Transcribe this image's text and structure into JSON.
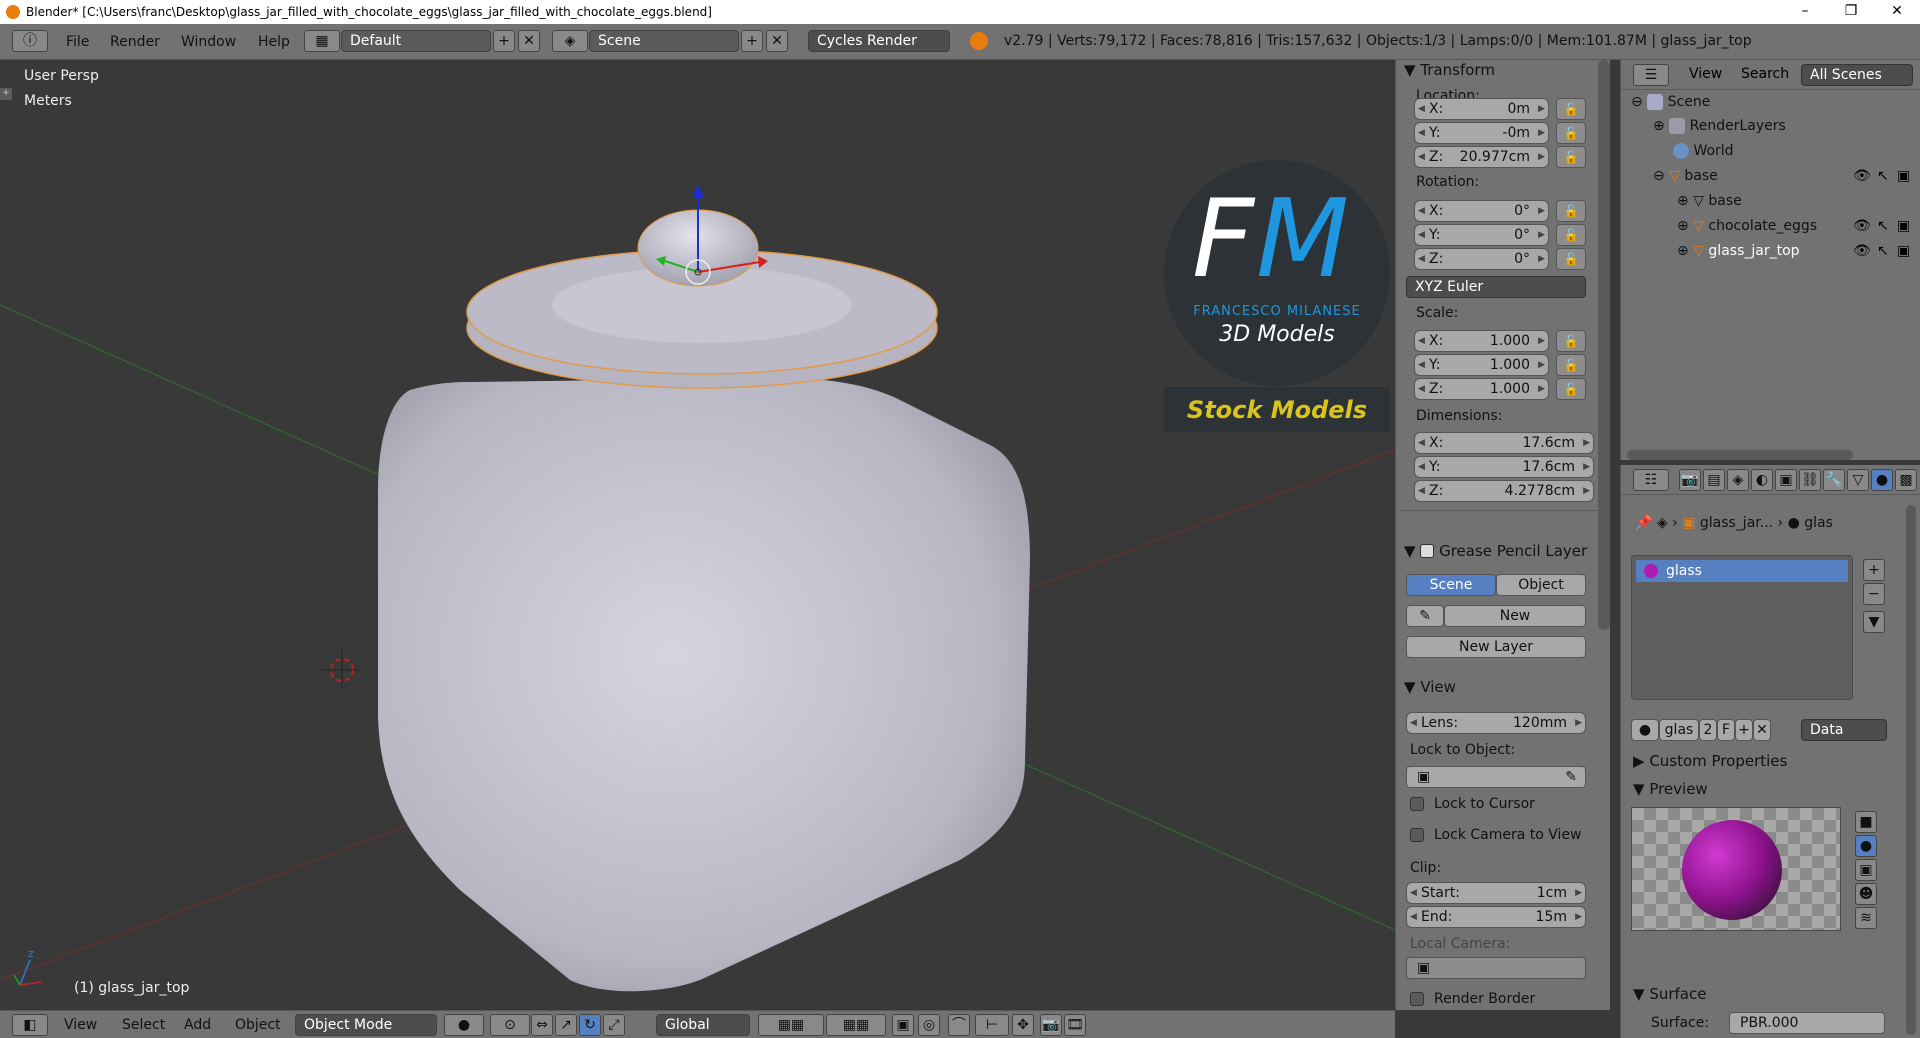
{
  "window": {
    "title": "Blender* [C:\\Users\\franc\\Desktop\\glass_jar_filled_with_chocolate_eggs\\glass_jar_filled_with_chocolate_eggs.blend]",
    "minimize": "–",
    "maximize": "❐",
    "close": "✕"
  },
  "menubar": {
    "menus": [
      "File",
      "Render",
      "Window",
      "Help"
    ],
    "layout": "Default",
    "scene": "Scene",
    "engine": "Cycles Render",
    "stats": "v2.79 | Verts:79,172 | Faces:78,816 | Tris:157,632 | Objects:1/3 | Lamps:0/0 | Mem:101.87M | glass_jar_top"
  },
  "viewport": {
    "view_name": "User Persp",
    "units": "Meters",
    "active_object": "(1) glass_jar_top",
    "axis_z": "z",
    "watermark": {
      "initials_f": "F",
      "initials_m": "M",
      "author": "FRANCESCO MILANESE",
      "sub": "3D Models",
      "stock": "Stock Models"
    }
  },
  "footer": {
    "menus": [
      "View",
      "Select",
      "Add",
      "Object"
    ],
    "mode": "Object Mode",
    "orientation": "Global"
  },
  "npanel": {
    "transform_header": "Transform",
    "location_label": "Location:",
    "location": [
      {
        "k": "X:",
        "v": "0m"
      },
      {
        "k": "Y:",
        "v": "-0m"
      },
      {
        "k": "Z:",
        "v": "20.977cm"
      }
    ],
    "rotation_label": "Rotation:",
    "rotation": [
      {
        "k": "X:",
        "v": "0°"
      },
      {
        "k": "Y:",
        "v": "0°"
      },
      {
        "k": "Z:",
        "v": "0°"
      }
    ],
    "rotation_mode": "XYZ Euler",
    "scale_label": "Scale:",
    "scale": [
      {
        "k": "X:",
        "v": "1.000"
      },
      {
        "k": "Y:",
        "v": "1.000"
      },
      {
        "k": "Z:",
        "v": "1.000"
      }
    ],
    "dimensions_label": "Dimensions:",
    "dimensions": [
      {
        "k": "X:",
        "v": "17.6cm"
      },
      {
        "k": "Y:",
        "v": "17.6cm"
      },
      {
        "k": "Z:",
        "v": "4.2778cm"
      }
    ],
    "gp_header": "Grease Pencil Layer",
    "gp_scene": "Scene",
    "gp_object": "Object",
    "gp_new": "New",
    "gp_new_layer": "New Layer",
    "view_header": "View",
    "lens_k": "Lens:",
    "lens_v": "120mm",
    "lock_to_object": "Lock to Object:",
    "lock_to_cursor": "Lock to Cursor",
    "lock_camera": "Lock Camera to View",
    "clip_label": "Clip:",
    "clip_start_k": "Start:",
    "clip_start_v": "1cm",
    "clip_end_k": "End:",
    "clip_end_v": "15m",
    "local_camera": "Local Camera:",
    "render_border": "Render Border"
  },
  "outliner": {
    "tabs": [
      "View",
      "Search",
      "All Scenes"
    ],
    "items": [
      {
        "label": "Scene"
      },
      {
        "label": "RenderLayers"
      },
      {
        "label": "World"
      },
      {
        "label": "base"
      },
      {
        "label": "base"
      },
      {
        "label": "chocolate_eggs"
      },
      {
        "label": "glass_jar_top"
      }
    ]
  },
  "properties": {
    "breadcrumb_obj": "glass_jar...",
    "breadcrumb_mat": "glas",
    "slot_name": "glass",
    "mat_name": "glas",
    "users": "2",
    "fake": "F",
    "link": "Data",
    "custom_props": "Custom Properties",
    "preview": "Preview",
    "surface_header": "Surface",
    "surface_k": "Surface:",
    "surface_v": "PBR.000"
  },
  "colors": {
    "ui_bg": "#727272",
    "viewport_bg": "#393939",
    "selected": "#5680c2",
    "jar": "#c9c7d3",
    "stock_text": "#d8c41a",
    "fm_blue": "#1f97e0"
  }
}
